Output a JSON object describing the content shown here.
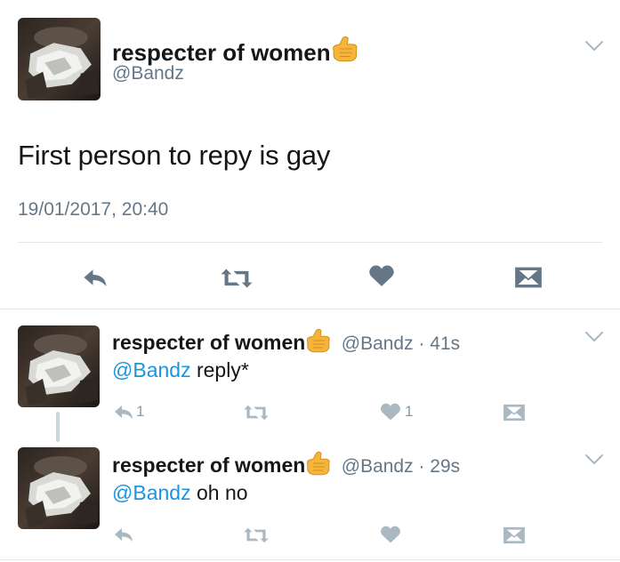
{
  "colors": {
    "text": "#14171a",
    "secondary": "#657786",
    "icon_dark": "#657786",
    "icon_light": "#aab8c2",
    "mention": "#1b95e0",
    "divider": "#e1e8ed"
  },
  "main_tweet": {
    "name": "respecter of women",
    "name_emoji": "call-me-hand-emoji",
    "handle": "@Bandz",
    "text": "First person to repy is gay",
    "timestamp": "19/01/2017, 20:40",
    "actions": [
      "reply-icon",
      "retweet-icon",
      "like-icon",
      "direct-message-icon"
    ]
  },
  "replies": [
    {
      "name": "respecter of women",
      "handle_time": "@Bandz · 41s",
      "mention": "@Bandz",
      "text": " reply*",
      "reply_count": "1",
      "like_count": "1"
    },
    {
      "name": "respecter of women",
      "handle_time": "@Bandz · 29s",
      "mention": "@Bandz",
      "text": " oh no"
    }
  ]
}
